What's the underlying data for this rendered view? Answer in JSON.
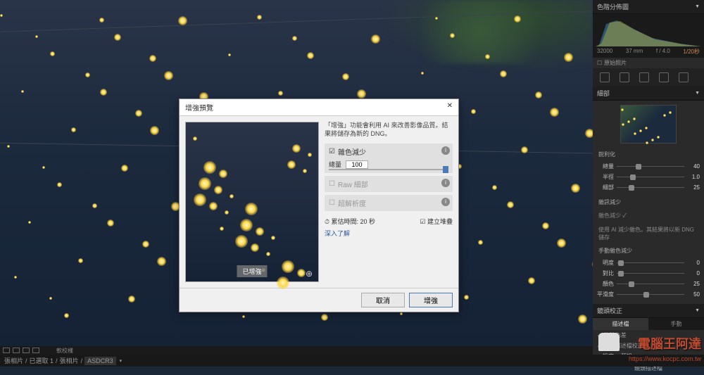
{
  "sidebar": {
    "histogram_title": "色階分佈圖",
    "histo_iso": "32000",
    "histo_focal": "37 mm",
    "histo_aperture": "f / 4.0",
    "histo_shutter": "1/20秒",
    "original_chk": "原始照片",
    "detail_title": "細部",
    "sharpen_section": "銳利化",
    "noise_section": "雜訊減少",
    "noise_sub": "雜色減少 ✓",
    "noise_desc": "使用 AI 減少雜色。其結果將以新 DNG 儲存",
    "manual_noise": "手動雜色減少",
    "sliders": {
      "amount": {
        "label": "總量",
        "value": "40"
      },
      "radius": {
        "label": "半徑",
        "value": "1.0"
      },
      "detail": {
        "label": "細部",
        "value": "25"
      },
      "luminance": {
        "label": "明度",
        "value": "0"
      },
      "contrast": {
        "label": "對比",
        "value": "0"
      },
      "color": {
        "label": "顏色",
        "value": "25"
      },
      "smooth": {
        "label": "平滑度",
        "value": "50"
      }
    },
    "lens_title": "鏡頭校正",
    "tab_profile": "描述檔",
    "tab_manual": "手動",
    "remove_ca": "移除色差",
    "enable_profile": "啟動描述檔校正",
    "setup": "設定",
    "preset": "預設",
    "lens_profile": "鏡頭描述檔"
  },
  "dialog": {
    "title": "增強預覽",
    "description": "「增強」功能會利用 AI 來改善影像品質。結果將儲存為新的 DNG。",
    "noise_reduce": "雜色減少",
    "amount_label": "總量",
    "amount_value": "100",
    "raw_detail": "Raw 細部",
    "super_res": "超解析度",
    "time_est": "累估時間: 20 秒",
    "create_stack": "建立堆疊",
    "learn_more": "深入了解",
    "preview_badge": "已增強",
    "cancel": "取消",
    "enhance": "增強"
  },
  "bottombar": {
    "soft_proof": "軟校樣"
  },
  "breadcrumb": {
    "p1": "張相片",
    "p2": "已選取 1",
    "p3": "張相片",
    "p4": "ASDCR3"
  },
  "watermark": {
    "main": "電腦王阿達",
    "sub": "https://www.kocpc.com.tw"
  }
}
